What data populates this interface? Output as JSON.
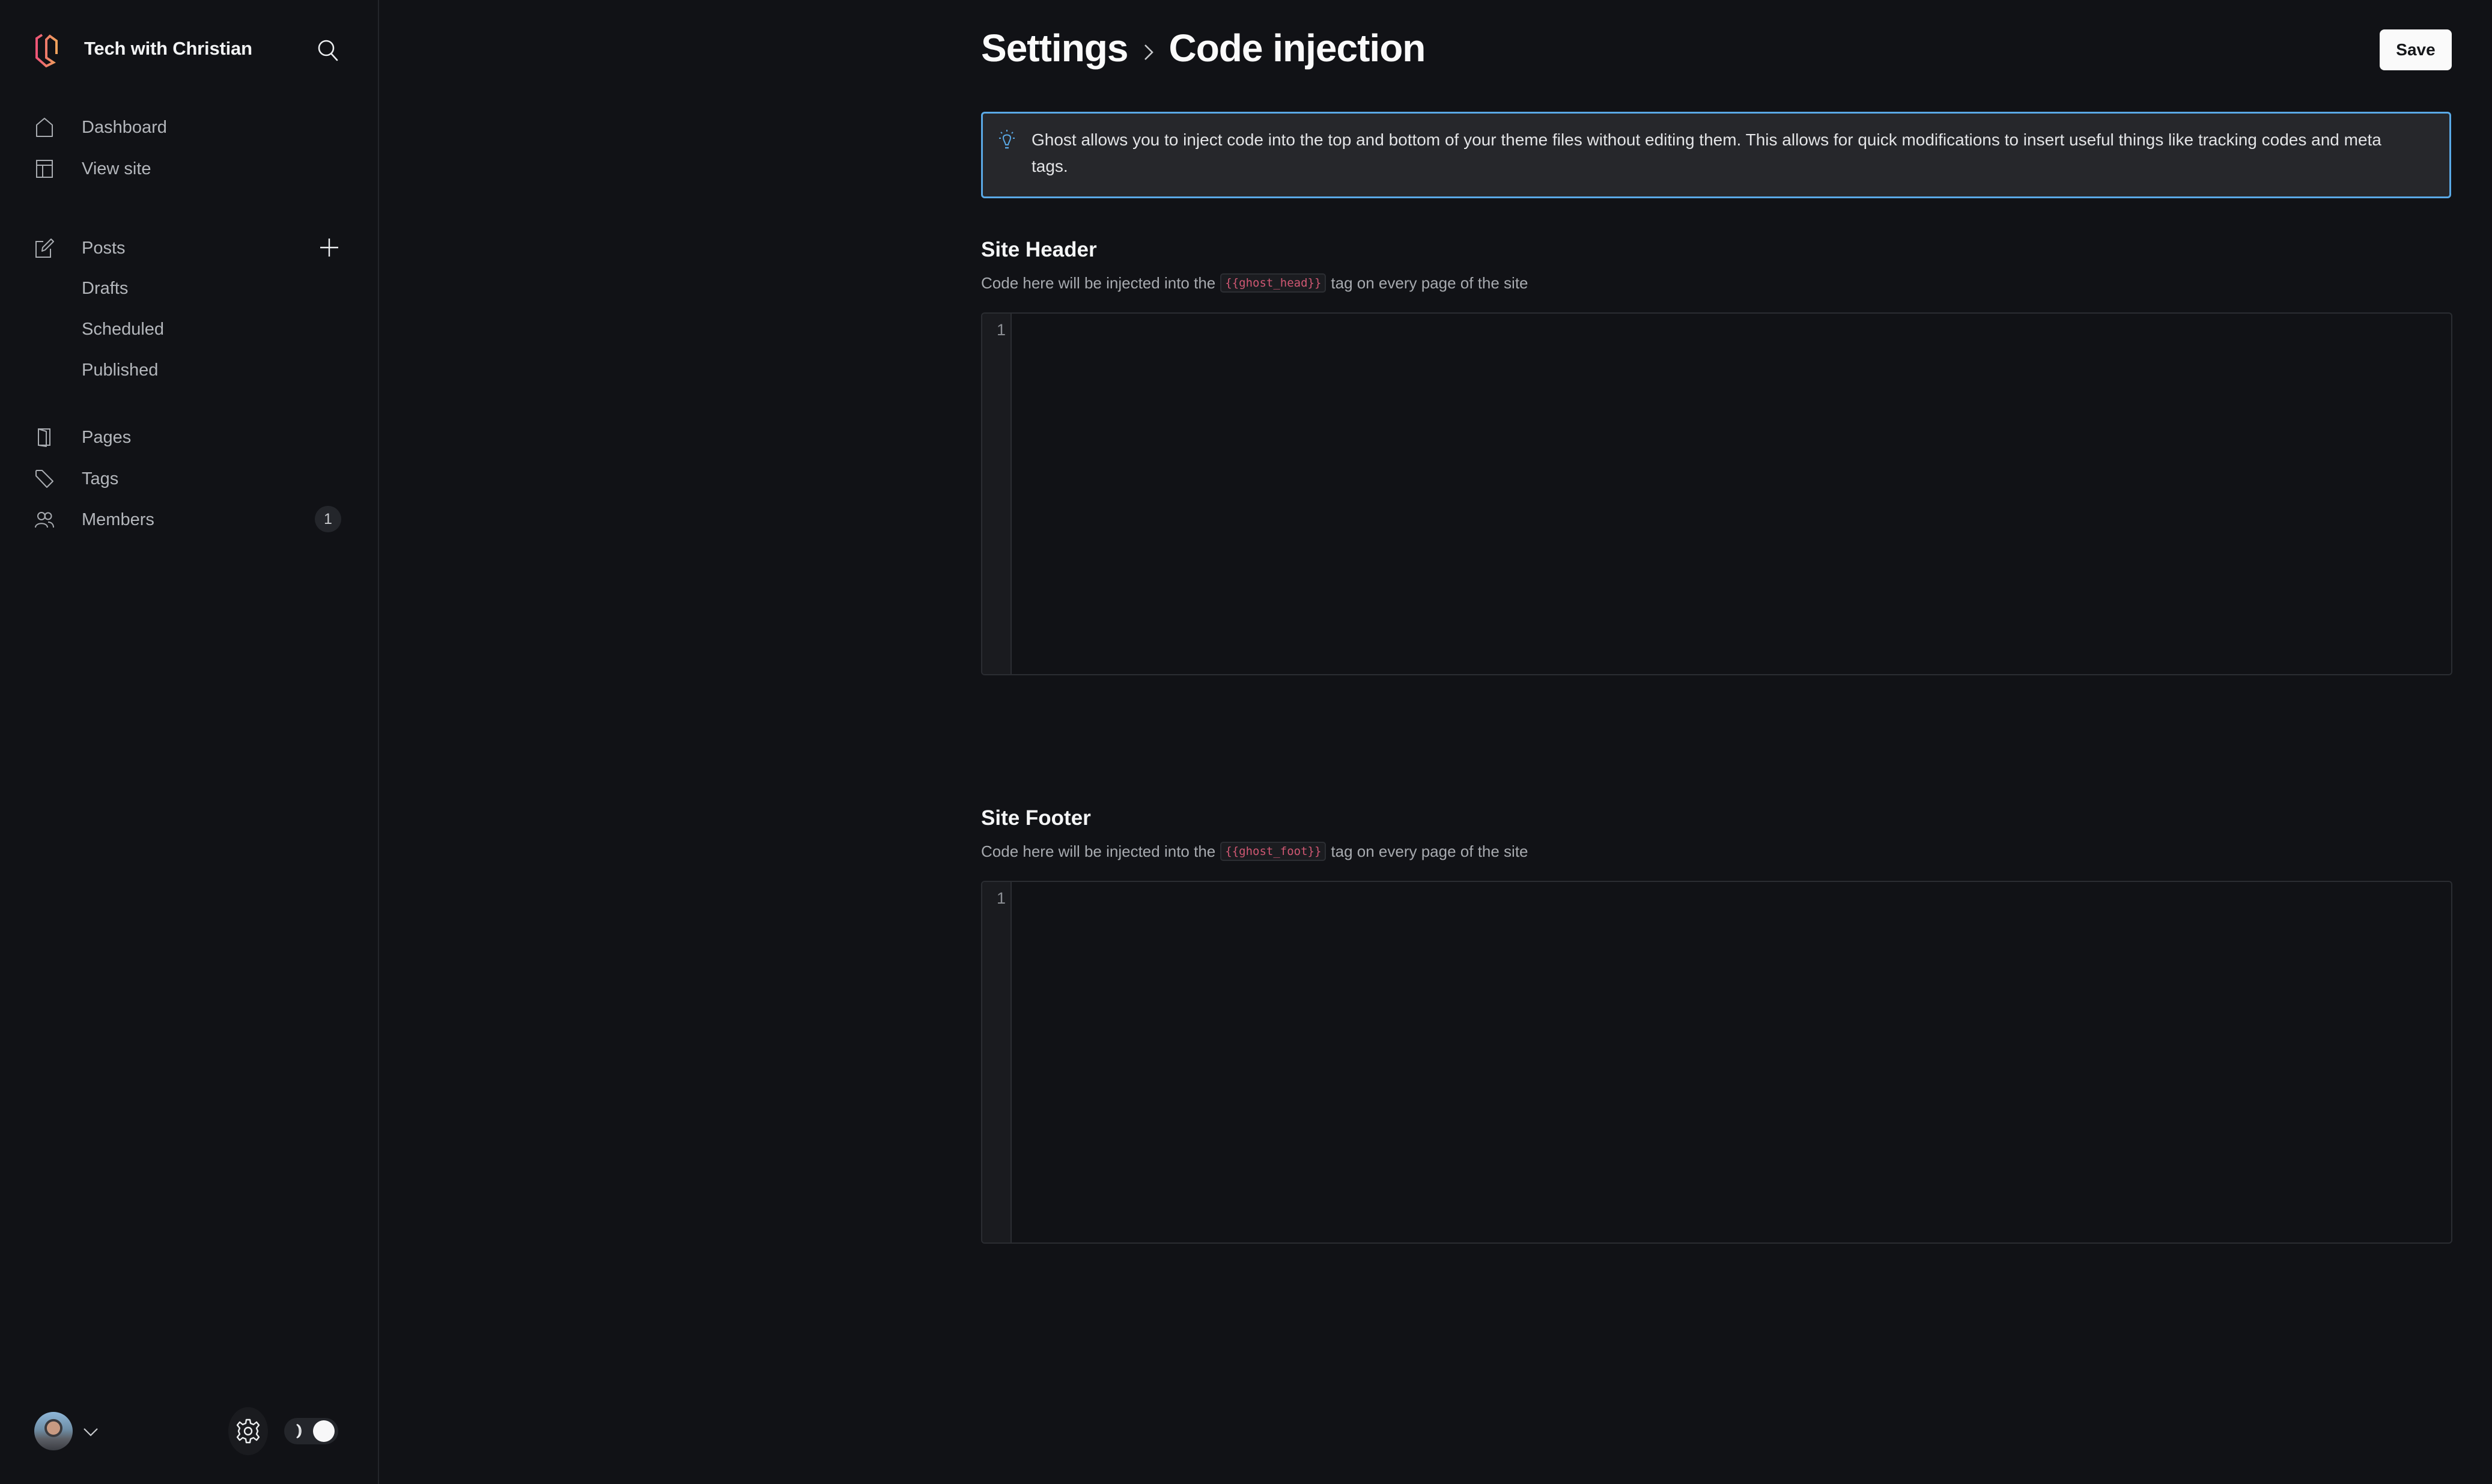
{
  "sidebar": {
    "site_title": "Tech with Christian",
    "logo_colors": {
      "start": "#ef5a7a",
      "end": "#f0a05a"
    },
    "search_icon": "search-icon",
    "nav": [
      {
        "label": "Dashboard",
        "icon": "home-icon"
      },
      {
        "label": "View site",
        "icon": "layout-icon"
      }
    ],
    "posts": {
      "label": "Posts",
      "icon": "edit-icon",
      "add_icon": "plus-icon",
      "subitems": [
        {
          "label": "Drafts"
        },
        {
          "label": "Scheduled"
        },
        {
          "label": "Published"
        }
      ]
    },
    "content_nav": [
      {
        "label": "Pages",
        "icon": "page-icon"
      },
      {
        "label": "Tags",
        "icon": "tag-icon"
      },
      {
        "label": "Members",
        "icon": "members-icon",
        "badge": "1"
      }
    ],
    "footer": {
      "avatar_icon": "user-avatar",
      "menu_icon": "chevron-down-icon",
      "settings_icon": "gear-icon",
      "theme_toggle": {
        "mode": "dark",
        "icon": "moon-icon"
      }
    }
  },
  "header": {
    "breadcrumb_parent": "Settings",
    "breadcrumb_separator_icon": "chevron-right-icon",
    "title": "Code injection",
    "save_label": "Save"
  },
  "info": {
    "icon": "lightbulb-icon",
    "text": "Ghost allows you to inject code into the top and bottom of your theme files without editing them. This allows for quick modifications to insert useful things like tracking codes and meta tags.",
    "accent_color": "#5aa9e6"
  },
  "site_header": {
    "title": "Site Header",
    "desc_before": "Code here will be injected into the",
    "tag": "{{ghost_head}}",
    "desc_after": "tag on every page of the site",
    "line_number": "1",
    "value": ""
  },
  "site_footer": {
    "title": "Site Footer",
    "desc_before": "Code here will be injected into the",
    "tag": "{{ghost_foot}}",
    "desc_after": "tag on every page of the site",
    "line_number": "1",
    "value": ""
  }
}
